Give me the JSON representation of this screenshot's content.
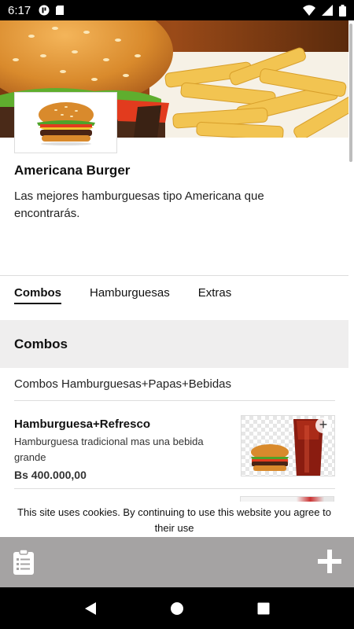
{
  "status_bar": {
    "time": "6:17"
  },
  "store": {
    "name": "Americana Burger",
    "description": "Las mejores hamburguesas tipo Americana que encontrarás."
  },
  "tabs": [
    {
      "label": "Combos",
      "active": true
    },
    {
      "label": "Hamburguesas",
      "active": false
    },
    {
      "label": "Extras",
      "active": false
    }
  ],
  "section": {
    "title": "Combos",
    "subtitle": "Combos Hamburguesas+Papas+Bebidas"
  },
  "products": [
    {
      "name": "Hamburguesa+Refresco",
      "description": "Hamburguesa tradicional mas una bebida grande",
      "price": "Bs 400.000,00",
      "add_icon": "plus-icon"
    }
  ],
  "cookie_notice": "This site uses cookies. By continuing to use this website you agree to their use",
  "bottom_bar": {
    "left_icon": "clipboard-list-icon",
    "right_icon": "plus-icon"
  },
  "colors": {
    "bottom_bar": "#a5a3a3",
    "section_header": "#efeeee"
  }
}
